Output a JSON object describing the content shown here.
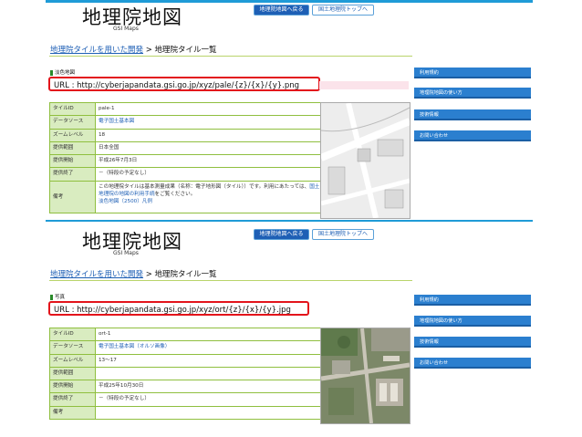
{
  "panels": [
    {
      "logo_main": "地理院地図",
      "logo_sub": "GSI Maps",
      "nav_buttons": [
        "地理院地図へ戻る",
        "国土地理院トップへ"
      ],
      "breadcrumb": {
        "link": "地理院タイルを用いた開発",
        "sep": " > ",
        "current": "地理院タイル一覧"
      },
      "section_title": "淡色地図",
      "url": "URL : http://cyberjapandata.gsi.go.jp/xyz/pale/{z}/{x}/{y}.png",
      "rows": [
        {
          "label": "タイルID",
          "value": "pale-1"
        },
        {
          "label": "データソース",
          "value": "電子国土基本図"
        },
        {
          "label": "ズームレベル",
          "value": "18"
        },
        {
          "label": "提供範囲",
          "value": "日本全国"
        },
        {
          "label": "提供開始",
          "value": "平成26年7月3日"
        },
        {
          "label": "提供終了",
          "value": "－（特段の予定なし）"
        }
      ],
      "note_label": "備考",
      "note_text": "この地理院タイルは基本測量成果（名称：電子地形図（タイル））です。利用にあたっては、",
      "note_link1": "国土地理院の地図の利用手続",
      "note_text2": "をご覧ください。",
      "note_link2": "淡色地図（2500）凡例",
      "preview_type": "map",
      "sidebar": [
        "利用規約",
        "地理院地図の使い方",
        "技術情報",
        "お問い合わせ"
      ]
    },
    {
      "logo_main": "地理院地図",
      "logo_sub": "GSI Maps",
      "nav_buttons": [
        "地理院地図へ戻る",
        "国土地理院トップへ"
      ],
      "breadcrumb": {
        "link": "地理院タイルを用いた開発",
        "sep": " > ",
        "current": "地理院タイル一覧"
      },
      "section_title": "写真",
      "url": "URL : http://cyberjapandata.gsi.go.jp/xyz/ort/{z}/{x}/{y}.jpg",
      "rows": [
        {
          "label": "タイルID",
          "value": "ort-1"
        },
        {
          "label": "データソース",
          "value": "電子国土基本図（オルソ画像）"
        },
        {
          "label": "ズームレベル",
          "value": "13〜17"
        },
        {
          "label": "提供範囲",
          "value": ""
        },
        {
          "label": "提供開始",
          "value": "平成25年10月30日"
        },
        {
          "label": "提供終了",
          "value": "－（特段の予定なし）"
        },
        {
          "label": "備考",
          "value": ""
        }
      ],
      "preview_type": "photo",
      "sidebar": [
        "利用規約",
        "地理院地図の使い方",
        "技術情報",
        "お問い合わせ"
      ]
    }
  ],
  "colors": {
    "accent": "#1f9bd7",
    "url_highlight": "#e3141b",
    "table_border": "#8fbf3f",
    "label_bg": "#d9ecc0",
    "sidebar": "#2b7fcf"
  }
}
